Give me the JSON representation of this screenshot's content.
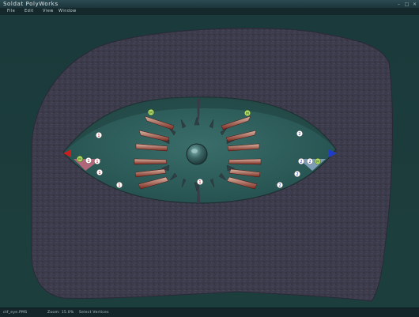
{
  "window": {
    "title": "Soldat PolyWorks",
    "controls": [
      "–",
      "□",
      "✕"
    ]
  },
  "menu": {
    "file": "File",
    "edit": "Edit",
    "view": "View",
    "window": "Window"
  },
  "status": {
    "map_name": "ctf_eye.PMS",
    "zoom": "Zoom: 15.0%",
    "tool": "Select Vertices"
  },
  "colors": {
    "background": "#1d3b3b",
    "rock": "#3d3c4c",
    "interior": "#2b5754",
    "alpha_flag": "#c81e1e",
    "bravo_flag": "#1e3cc8"
  },
  "map": {
    "spawn_markers": [
      {
        "label": "1",
        "color": "#ffffff",
        "text": "#b01818"
      },
      {
        "label": "1",
        "color": "#ffffff",
        "text": "#b01818"
      },
      {
        "label": "1",
        "color": "#ffffff",
        "text": "#b01818"
      },
      {
        "label": "1",
        "color": "#ffffff",
        "text": "#b01818"
      },
      {
        "label": "1",
        "color": "#ffffff",
        "text": "#b01818"
      },
      {
        "label": "1",
        "color": "#ffffff",
        "text": "#b01818"
      },
      {
        "label": "2",
        "color": "#ffffff",
        "text": "#1838b0"
      },
      {
        "label": "2",
        "color": "#ffffff",
        "text": "#1838b0"
      },
      {
        "label": "2",
        "color": "#ffffff",
        "text": "#1838b0"
      },
      {
        "label": "2",
        "color": "#ffffff",
        "text": "#1838b0"
      },
      {
        "label": "2",
        "color": "#ffffff",
        "text": "#1838b0"
      },
      {
        "label": "M",
        "color": "#b8e070",
        "text": "#2a5010"
      },
      {
        "label": "M",
        "color": "#b8e070",
        "text": "#2a5010"
      },
      {
        "label": "M",
        "color": "#b8e070",
        "text": "#2a5010"
      },
      {
        "label": "M",
        "color": "#b8e070",
        "text": "#2a5010"
      }
    ]
  }
}
